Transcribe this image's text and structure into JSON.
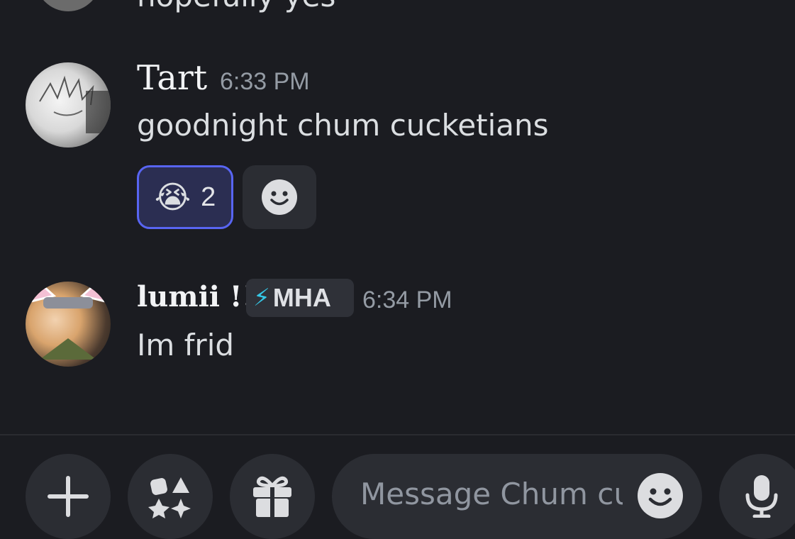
{
  "previous_message": {
    "text": "hopefully yes"
  },
  "messages": [
    {
      "username": "Tart",
      "timestamp": "6:33 PM",
      "text": "goodnight chum cucketians",
      "reactions": [
        {
          "emoji": "😭",
          "count": "2",
          "active": true
        }
      ]
    },
    {
      "username": "lumii !!",
      "tag": {
        "icon": "⚡",
        "label": "MHA"
      },
      "timestamp": "6:34 PM",
      "text": "Im frid"
    }
  ],
  "composer": {
    "placeholder": "Message Chum cucketians",
    "buttons": [
      "plus-icon",
      "apps-icon",
      "gift-icon",
      "emoji-icon",
      "microphone-icon"
    ]
  },
  "colors": {
    "background": "#1b1c21",
    "reaction_active_border": "#5865f2",
    "reaction_active_bg": "#2b2e52",
    "button_bg": "#2b2d33"
  }
}
